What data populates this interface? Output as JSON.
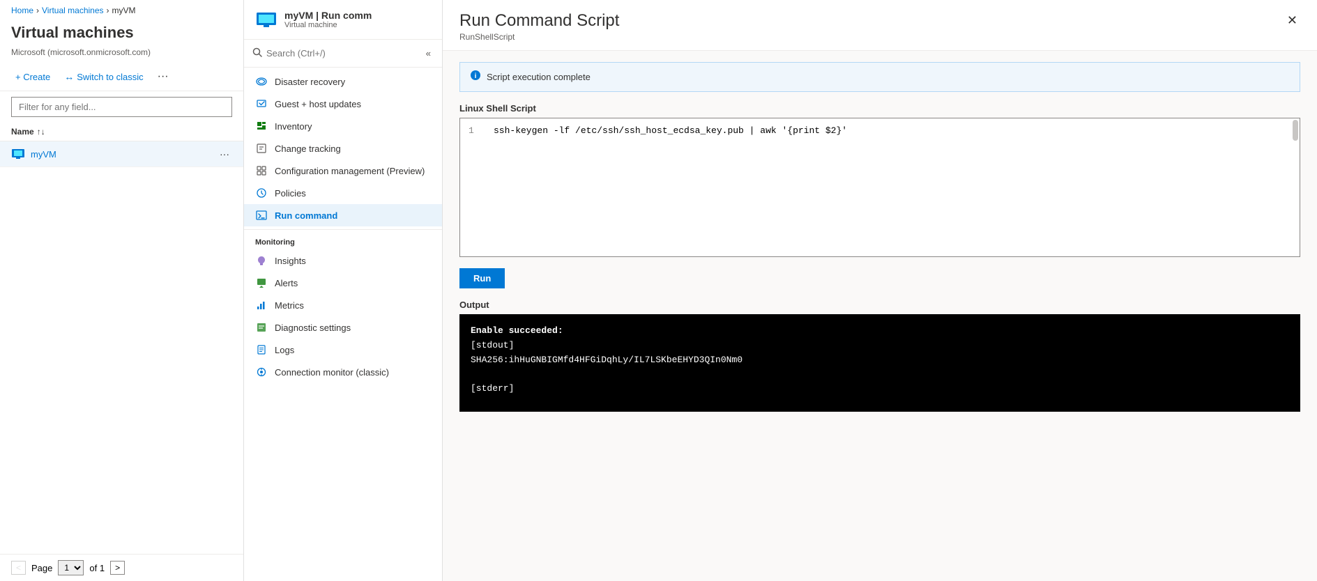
{
  "breadcrumb": {
    "home": "Home",
    "vms": "Virtual machines",
    "vm": "myVM",
    "separator": "›"
  },
  "left_panel": {
    "title": "Virtual machines",
    "subtitle": "Microsoft (microsoft.onmicrosoft.com)",
    "create_label": "+ Create",
    "switch_label": "Switch to classic",
    "more_icon": "···",
    "filter_placeholder": "Filter for any field...",
    "column_name": "Name",
    "sort_icon": "↑↓",
    "vm_row": {
      "name": "myVM",
      "more_icon": "···"
    },
    "pagination": {
      "prev_label": "<",
      "next_label": ">",
      "page_label": "Page",
      "page_value": "1",
      "of_label": "of 1"
    }
  },
  "sidebar": {
    "vm_title": "myVM | Run comm",
    "vm_subtitle": "Virtual machine",
    "search_placeholder": "Search (Ctrl+/)",
    "collapse_icon": "«",
    "menu_items": [
      {
        "id": "disaster-recovery",
        "label": "Disaster recovery",
        "icon": "cloud"
      },
      {
        "id": "guest-host-updates",
        "label": "Guest + host updates",
        "icon": "refresh-circle"
      },
      {
        "id": "inventory",
        "label": "Inventory",
        "icon": "box"
      },
      {
        "id": "change-tracking",
        "label": "Change tracking",
        "icon": "list-alt"
      },
      {
        "id": "configuration-management",
        "label": "Configuration management (Preview)",
        "icon": "grid"
      },
      {
        "id": "policies",
        "label": "Policies",
        "icon": "shield"
      },
      {
        "id": "run-command",
        "label": "Run command",
        "icon": "terminal",
        "active": true
      }
    ],
    "monitoring_section": "Monitoring",
    "monitoring_items": [
      {
        "id": "insights",
        "label": "Insights",
        "icon": "lightbulb"
      },
      {
        "id": "alerts",
        "label": "Alerts",
        "icon": "bell"
      },
      {
        "id": "metrics",
        "label": "Metrics",
        "icon": "chart"
      },
      {
        "id": "diagnostic-settings",
        "label": "Diagnostic settings",
        "icon": "settings-list"
      },
      {
        "id": "logs",
        "label": "Logs",
        "icon": "scroll"
      },
      {
        "id": "connection-monitor",
        "label": "Connection monitor (classic)",
        "icon": "network"
      }
    ]
  },
  "rcs": {
    "title": "Run Command Script",
    "subtitle": "RunShellScript",
    "close_icon": "✕",
    "info_banner": "Script execution complete",
    "script_section_label": "Linux Shell Script",
    "script_line_num": "1",
    "script_code": "ssh-keygen -lf /etc/ssh/ssh_host_ecdsa_key.pub | awk '{print $2}'",
    "run_button_label": "Run",
    "output_label": "Output",
    "output_lines": [
      "Enable succeeded:",
      "[stdout]",
      "SHA256:ihHuGNBIGMfd4HFGiDqhLy/IL7LSKbeEHYD3QIn0Nm0",
      "",
      "[stderr]"
    ]
  }
}
